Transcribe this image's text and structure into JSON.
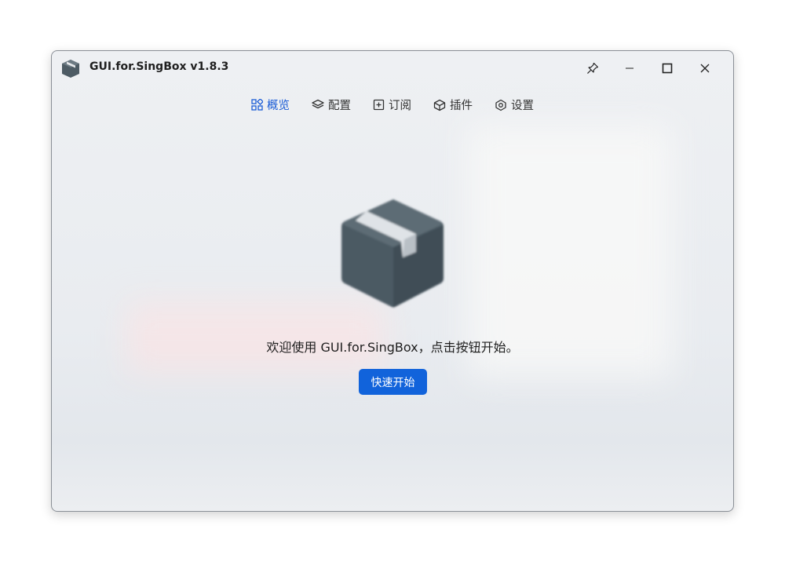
{
  "window": {
    "title": "GUI.for.SingBox v1.8.3"
  },
  "controls": {
    "pin_icon": "pin-icon",
    "minimize_icon": "minimize-icon",
    "maximize_icon": "maximize-icon",
    "close_icon": "close-icon"
  },
  "nav": {
    "items": [
      {
        "label": "概览",
        "icon": "overview-grid-icon",
        "active": true
      },
      {
        "label": "配置",
        "icon": "layers-icon",
        "active": false
      },
      {
        "label": "订阅",
        "icon": "add-square-icon",
        "active": false
      },
      {
        "label": "插件",
        "icon": "cube-icon",
        "active": false
      },
      {
        "label": "设置",
        "icon": "settings-hex-icon",
        "active": false
      }
    ]
  },
  "main": {
    "hero_icon": "package-box-icon",
    "welcome_text": "欢迎使用 GUI.for.SingBox，点击按钮开始。",
    "start_button_label": "快速开始"
  },
  "colors": {
    "accent": "#1163db",
    "active_nav": "#1b5cd6",
    "box_dark": "#4b5a63"
  }
}
